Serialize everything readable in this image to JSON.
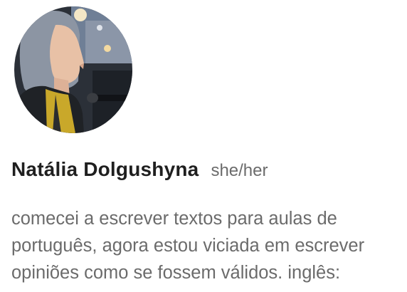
{
  "profile": {
    "avatar_alt": "Natália Dolgushyna",
    "name": "Natália Dolgushyna",
    "pronouns": "she/her",
    "bio_lines": [
      "comecei a escrever textos para aulas de",
      "português, agora estou viciada em escrever",
      "opiniões como se fossem válidos. inglês:"
    ]
  }
}
